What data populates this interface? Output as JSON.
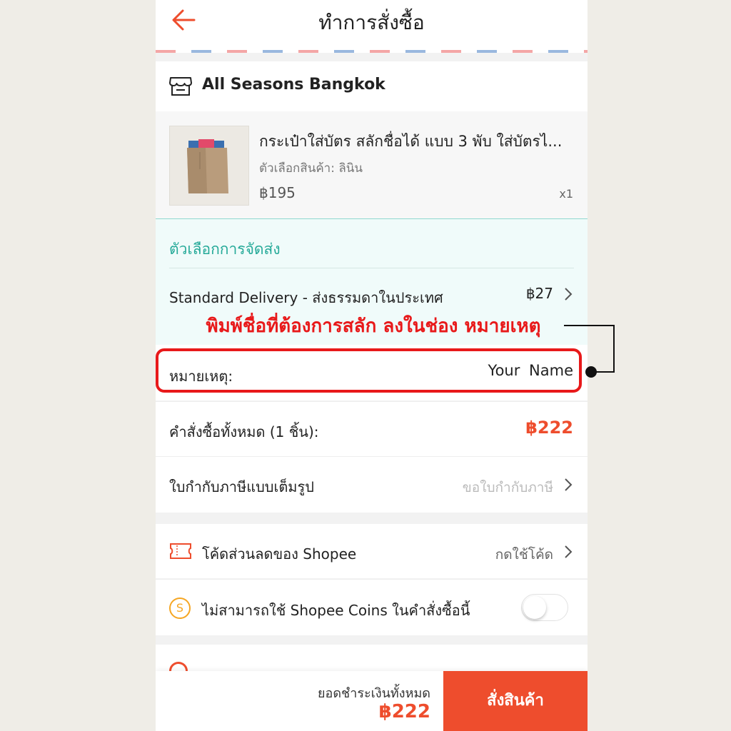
{
  "header": {
    "title": "ทำการสั่งซื้อ"
  },
  "shop": {
    "name": "All Seasons Bangkok"
  },
  "product": {
    "name": "กระเป๋าใส่บัตร สลักชื่อได้ แบบ 3 พับ ใส่บัตรไ...",
    "variant": "ตัวเลือกสินค้า: ลินิน",
    "price": "฿195",
    "qty": "x1"
  },
  "shipping": {
    "title": "ตัวเลือกการจัดส่ง",
    "method": "Standard Delivery - ส่งธรรมดาในประเทศ",
    "price": "฿27"
  },
  "annotation": {
    "text": "พิมพ์ชื่อที่ต้องการสลัก ลงในช่อง หมายเหตุ"
  },
  "note": {
    "label": "หมายเหตุ:",
    "value": "Your Name"
  },
  "order_total": {
    "label": "คำสั่งซื้อทั้งหมด (1 ชิ้น):",
    "value": "฿222"
  },
  "tax_invoice": {
    "label": "ใบกำกับภาษีแบบเต็มรูป",
    "action": "ขอใบกำกับภาษี"
  },
  "voucher": {
    "label": "โค้ดส่วนลดของ Shopee",
    "action": "กดใช้โค้ด"
  },
  "coins": {
    "label": "ไม่สามารถใช้ Shopee Coins ในคำสั่งซื้อนี้",
    "toggle_on": false
  },
  "footer": {
    "pay_label": "ยอดชำระเงินทั้งหมด",
    "pay_total": "฿222",
    "order_button": "สั่งสินค้า"
  },
  "colors": {
    "accent": "#ee4d2d",
    "teal": "#26aa99",
    "annotation": "#e8191a"
  }
}
